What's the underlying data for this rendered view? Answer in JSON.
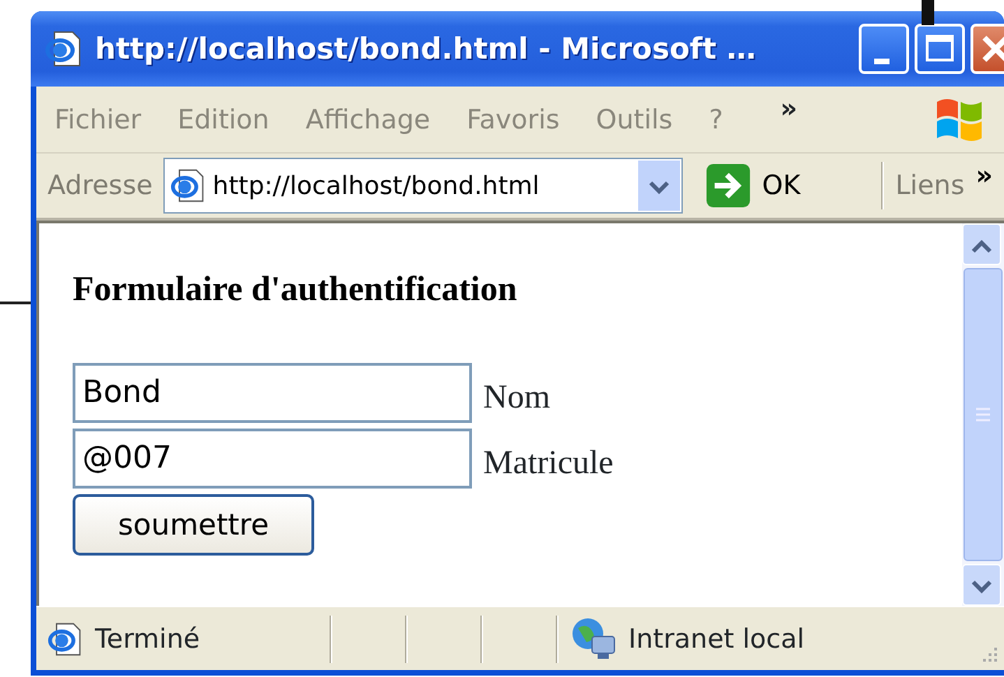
{
  "window": {
    "title": "http://localhost/bond.html - Microsoft …"
  },
  "menu_bar": {
    "items": [
      "Fichier",
      "Edition",
      "Affichage",
      "Favoris",
      "Outils",
      "?"
    ],
    "overflow": "»"
  },
  "address_bar": {
    "label": "Adresse",
    "url": "http://localhost/bond.html",
    "go_button": "OK",
    "links_label": "Liens",
    "overflow": "»"
  },
  "page": {
    "heading": "Formulaire d'authentification",
    "fields": [
      {
        "value": "Bond",
        "label": "Nom"
      },
      {
        "value": "@007",
        "label": "Matricule"
      }
    ],
    "submit_button": "soumettre"
  },
  "status_bar": {
    "status": "Terminé",
    "zone": "Intranet local"
  }
}
